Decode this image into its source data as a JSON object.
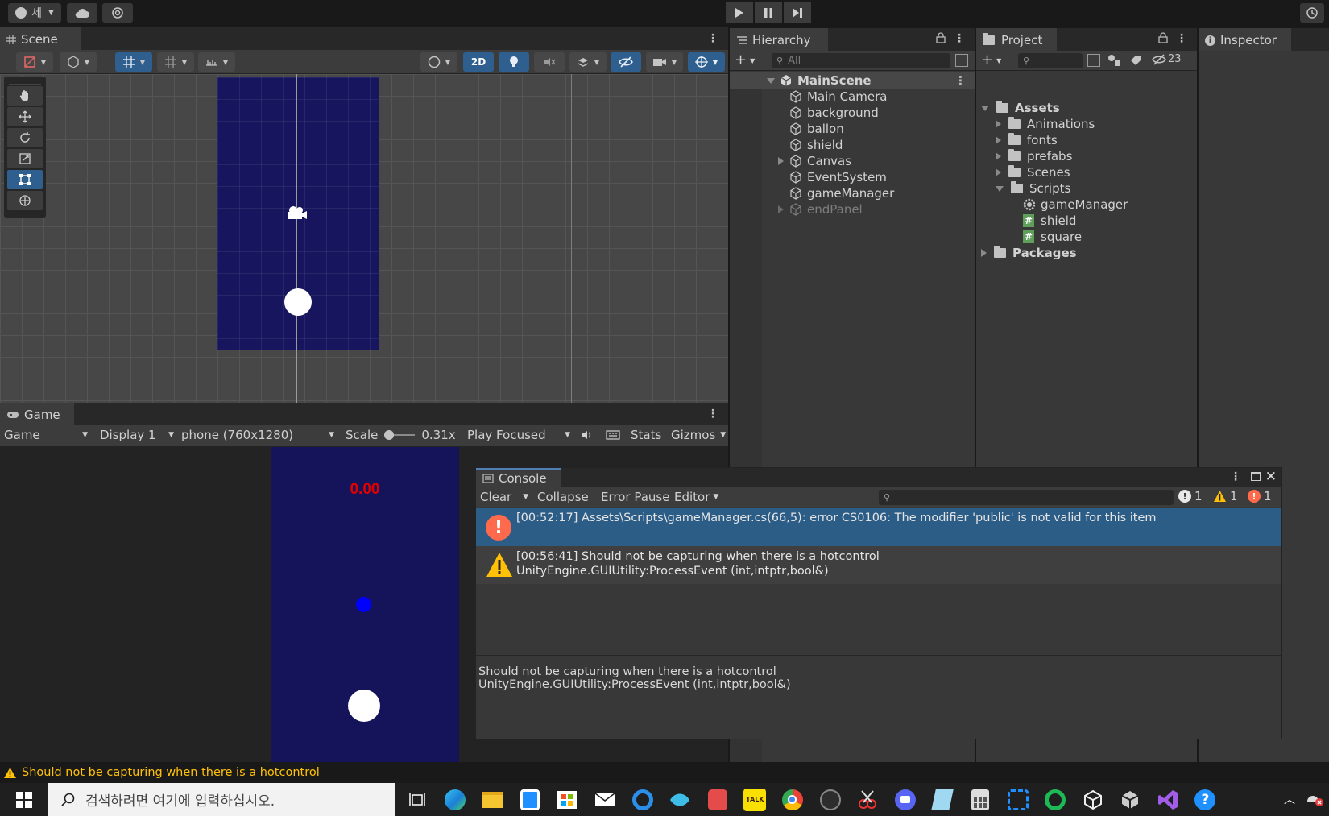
{
  "toolbar": {
    "account_label": "세"
  },
  "scene": {
    "tab_label": "Scene",
    "btn_2d": "2D"
  },
  "game": {
    "tab_label": "Game",
    "dropdown_game": "Game",
    "dropdown_display": "Display 1",
    "dropdown_resolution": "phone (760x1280)",
    "scale_label": "Scale",
    "scale_value": "0.31x",
    "play_mode": "Play Focused",
    "stats_label": "Stats",
    "gizmos_label": "Gizmos",
    "timer_text": "0.00",
    "timer_color": "#e00000",
    "background_color": "#15145a",
    "dot_color": "#0000ff"
  },
  "hierarchy": {
    "tab_label": "Hierarchy",
    "search_placeholder": "All",
    "scene_name": "MainScene",
    "items": [
      {
        "label": "Main Camera"
      },
      {
        "label": "background"
      },
      {
        "label": "ballon"
      },
      {
        "label": "shield"
      },
      {
        "label": "Canvas"
      },
      {
        "label": "EventSystem"
      },
      {
        "label": "gameManager"
      },
      {
        "label": "endPanel"
      }
    ]
  },
  "project": {
    "tab_label": "Project",
    "hidden_count": "23",
    "assets_label": "Assets",
    "folders": [
      {
        "label": "Animations"
      },
      {
        "label": "fonts"
      },
      {
        "label": "prefabs"
      },
      {
        "label": "Scenes"
      },
      {
        "label": "Scripts"
      }
    ],
    "scripts": [
      {
        "label": "gameManager",
        "icon": "gear-script-icon"
      },
      {
        "label": "shield",
        "icon": "csharp-script-icon"
      },
      {
        "label": "square",
        "icon": "csharp-script-icon"
      }
    ],
    "packages_label": "Packages"
  },
  "inspector": {
    "tab_label": "Inspector"
  },
  "console": {
    "tab_label": "Console",
    "clear_label": "Clear",
    "collapse_label": "Collapse",
    "error_pause_label": "Error Pause",
    "editor_label": "Editor",
    "count_info": "1",
    "count_warning": "1",
    "count_error": "1",
    "messages": [
      {
        "type": "error",
        "line1": "[00:52:17] Assets\\Scripts\\gameManager.cs(66,5): error CS0106: The modifier 'public' is not valid for this item",
        "line2": ""
      },
      {
        "type": "warning",
        "line1": "[00:56:41] Should not be capturing when there is a hotcontrol",
        "line2": "UnityEngine.GUIUtility:ProcessEvent (int,intptr,bool&)"
      }
    ],
    "detail_line1": "Should not be capturing when there is a hotcontrol",
    "detail_line2": "UnityEngine.GUIUtility:ProcessEvent (int,intptr,bool&)",
    "error_color": "#ff6a4d",
    "warning_color": "#ffc107",
    "selected_color": "#2c5d87"
  },
  "status": {
    "message": "Should not be capturing when there is a hotcontrol",
    "color": "#ffc107"
  },
  "taskbar": {
    "search_placeholder": "검색하려면 여기에 입력하십시오."
  }
}
